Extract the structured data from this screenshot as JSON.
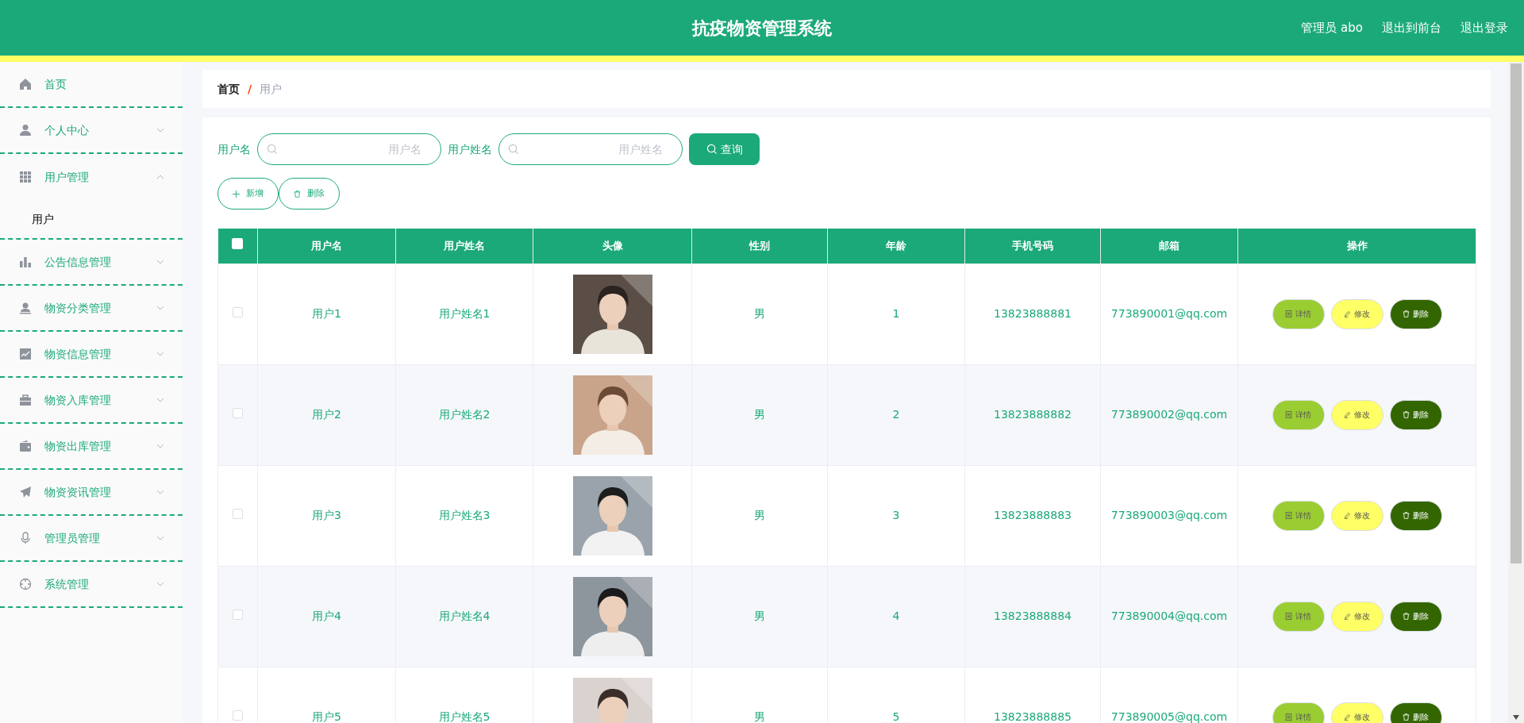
{
  "header": {
    "title": "抗疫物资管理系统",
    "links": [
      "管理员 abo",
      "退出到前台",
      "退出登录"
    ]
  },
  "sidebar": {
    "items": [
      {
        "label": "首页"
      },
      {
        "label": "个人中心",
        "expanded": false
      },
      {
        "label": "用户管理",
        "expanded": true,
        "children": [
          {
            "label": "用户",
            "selected": true
          }
        ]
      },
      {
        "label": "公告信息管理",
        "expanded": false
      },
      {
        "label": "物资分类管理",
        "expanded": false
      },
      {
        "label": "物资信息管理",
        "expanded": false
      },
      {
        "label": "物资入库管理",
        "expanded": false
      },
      {
        "label": "物资出库管理",
        "expanded": false
      },
      {
        "label": "物资资讯管理",
        "expanded": false
      },
      {
        "label": "管理员管理",
        "expanded": false
      },
      {
        "label": "系统管理",
        "expanded": false
      }
    ]
  },
  "breadcrumb": {
    "items": [
      "首页",
      "用户"
    ],
    "separator": "/"
  },
  "filters": [
    {
      "label": "用户名",
      "placeholder": "用户名"
    },
    {
      "label": "用户姓名",
      "placeholder": "用户姓名"
    }
  ],
  "search_button": "查询",
  "toolbar": [
    {
      "kind": "add",
      "label": "新增"
    },
    {
      "kind": "delete",
      "label": "删除"
    }
  ],
  "table": {
    "select_all_checked": false,
    "columns": [
      "用户名",
      "用户姓名",
      "头像",
      "性别",
      "年龄",
      "手机号码",
      "邮箱",
      "操作"
    ],
    "rows": [
      {
        "checked": false,
        "username": "用户1",
        "name": "用户姓名1",
        "gender": "男",
        "age": "1",
        "phone": "13823888881",
        "email": "773890001@qq.com",
        "actions": [
          {
            "kind": "detail",
            "label": "详情"
          },
          {
            "kind": "edit",
            "label": "修改"
          },
          {
            "kind": "delete",
            "label": "删除"
          }
        ]
      },
      {
        "checked": false,
        "username": "用户2",
        "name": "用户姓名2",
        "gender": "男",
        "age": "2",
        "phone": "13823888882",
        "email": "773890002@qq.com",
        "actions": [
          {
            "kind": "detail",
            "label": "详情"
          },
          {
            "kind": "edit",
            "label": "修改"
          },
          {
            "kind": "delete",
            "label": "删除"
          }
        ]
      },
      {
        "checked": false,
        "username": "用户3",
        "name": "用户姓名3",
        "gender": "男",
        "age": "3",
        "phone": "13823888883",
        "email": "773890003@qq.com",
        "actions": [
          {
            "kind": "detail",
            "label": "详情"
          },
          {
            "kind": "edit",
            "label": "修改"
          },
          {
            "kind": "delete",
            "label": "删除"
          }
        ]
      },
      {
        "checked": false,
        "username": "用户4",
        "name": "用户姓名4",
        "gender": "男",
        "age": "4",
        "phone": "13823888884",
        "email": "773890004@qq.com",
        "actions": [
          {
            "kind": "detail",
            "label": "详情"
          },
          {
            "kind": "edit",
            "label": "修改"
          },
          {
            "kind": "delete",
            "label": "删除"
          }
        ]
      },
      {
        "checked": false,
        "username": "用户5",
        "name": "用户姓名5",
        "gender": "男",
        "age": "5",
        "phone": "13823888885",
        "email": "773890005@qq.com",
        "actions": [
          {
            "kind": "detail",
            "label": "详情"
          },
          {
            "kind": "edit",
            "label": "修改"
          },
          {
            "kind": "delete",
            "label": "删除"
          }
        ]
      }
    ]
  }
}
